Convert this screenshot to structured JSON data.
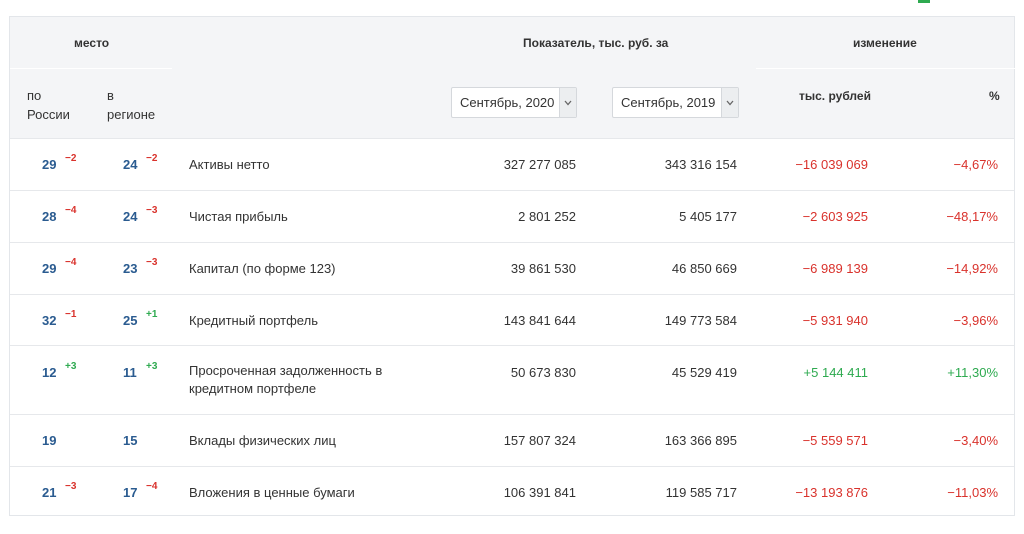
{
  "header": {
    "place": "место",
    "indicator": "Показатель, тыс. руб. за",
    "change": "изменение",
    "by_russia": [
      "по",
      "России"
    ],
    "in_region": [
      "в",
      "регионе"
    ],
    "period_1": "Сентябрь, 2020",
    "period_2": "Сентябрь, 2019",
    "thousand_rub": "тыс. рублей",
    "percent": "%"
  },
  "colors": {
    "rank_blue": "#2a5b90",
    "negative_red": "#d9322c",
    "positive_green": "#2eaa50",
    "header_bg": "#f4f5f7"
  },
  "rows": [
    {
      "rank_russia": "29",
      "rank_russia_delta": "−2",
      "rank_region": "24",
      "rank_region_delta": "−2",
      "name": [
        "Активы нетто"
      ],
      "value_2020": "327 277 085",
      "value_2019": "343 316 154",
      "change_abs": "−16 039 069",
      "change_pct": "−4,67%"
    },
    {
      "rank_russia": "28",
      "rank_russia_delta": "−4",
      "rank_region": "24",
      "rank_region_delta": "−3",
      "name": [
        "Чистая прибыль"
      ],
      "value_2020": "2 801 252",
      "value_2019": "5 405 177",
      "change_abs": "−2 603 925",
      "change_pct": "−48,17%"
    },
    {
      "rank_russia": "29",
      "rank_russia_delta": "−4",
      "rank_region": "23",
      "rank_region_delta": "−3",
      "name": [
        "Капитал (по форме 123)"
      ],
      "value_2020": "39 861 530",
      "value_2019": "46 850 669",
      "change_abs": "−6 989 139",
      "change_pct": "−14,92%"
    },
    {
      "rank_russia": "32",
      "rank_russia_delta": "−1",
      "rank_region": "25",
      "rank_region_delta": "+1",
      "name": [
        "Кредитный портфель"
      ],
      "value_2020": "143 841 644",
      "value_2019": "149 773 584",
      "change_abs": "−5 931 940",
      "change_pct": "−3,96%"
    },
    {
      "rank_russia": "12",
      "rank_russia_delta": "+3",
      "rank_region": "11",
      "rank_region_delta": "+3",
      "name": [
        "Просроченная задолженность в",
        "кредитном портфеле"
      ],
      "value_2020": "50 673 830",
      "value_2019": "45 529 419",
      "change_abs": "+5 144 411",
      "change_pct": "+11,30%"
    },
    {
      "rank_russia": "19",
      "rank_russia_delta": "",
      "rank_region": "15",
      "rank_region_delta": "",
      "name": [
        "Вклады физических лиц"
      ],
      "value_2020": "157 807 324",
      "value_2019": "163 366 895",
      "change_abs": "−5 559 571",
      "change_pct": "−3,40%"
    },
    {
      "rank_russia": "21",
      "rank_russia_delta": "−3",
      "rank_region": "17",
      "rank_region_delta": "−4",
      "name": [
        "Вложения в ценные бумаги"
      ],
      "value_2020": "106 391 841",
      "value_2019": "119 585 717",
      "change_abs": "−13 193 876",
      "change_pct": "−11,03%"
    }
  ]
}
